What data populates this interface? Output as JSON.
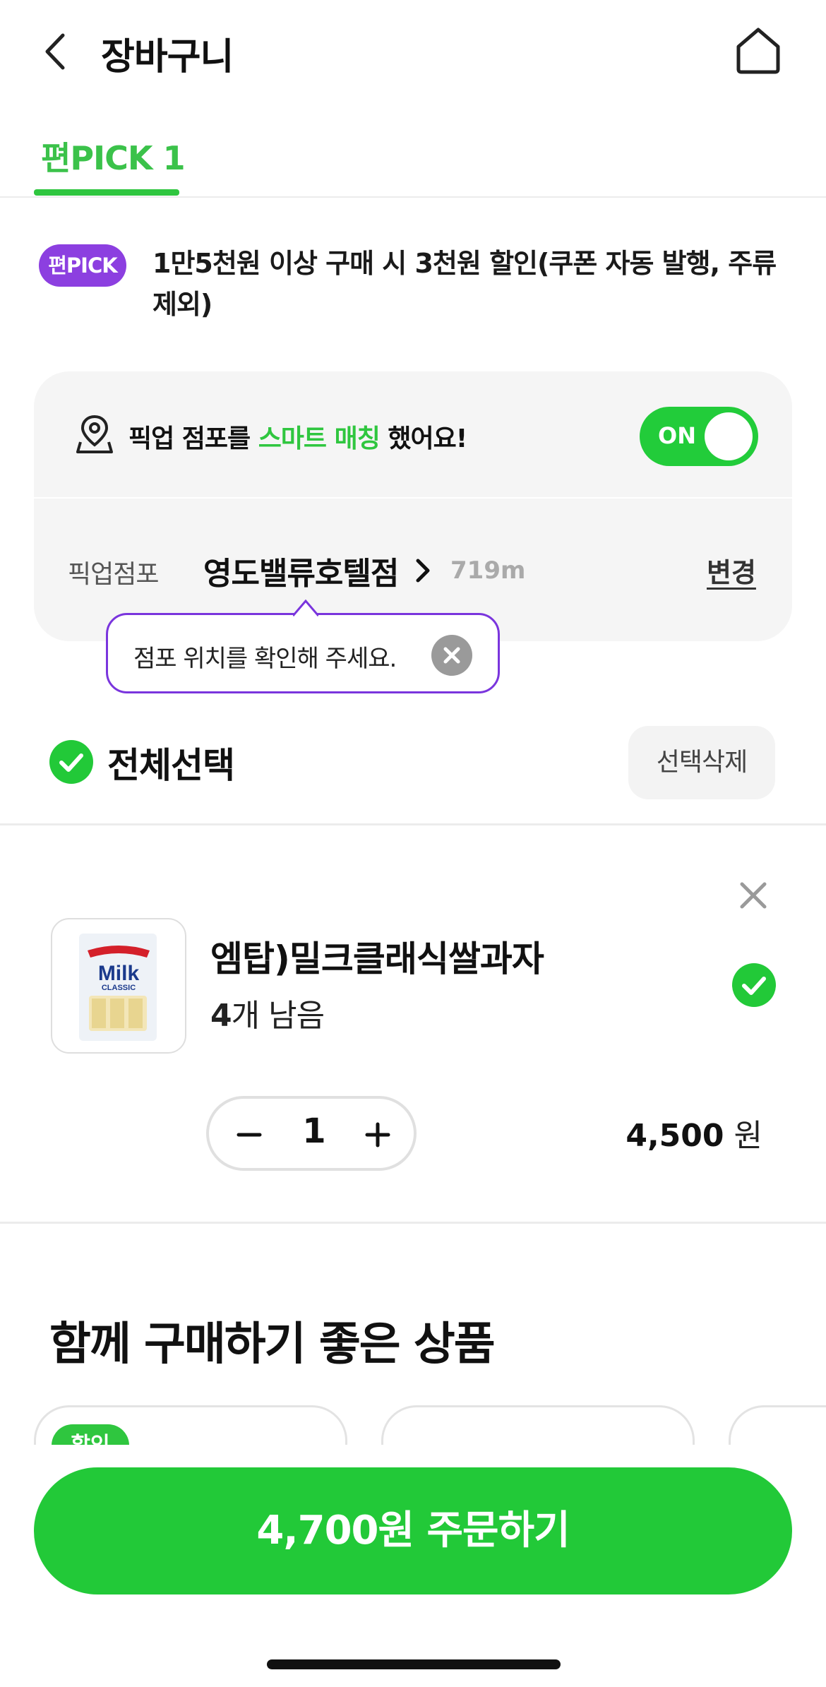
{
  "header": {
    "title": "장바구니",
    "back_icon": "chevron-left-icon",
    "home_icon": "home-icon"
  },
  "tabs": [
    {
      "label": "편PICK 1",
      "active": true
    }
  ],
  "promo": {
    "badge": "편PICK",
    "text": "1만5천원 이상 구매 시 3천원 할인(쿠폰 자동 발행, 주류 제외)"
  },
  "pickup": {
    "smart_prefix": "픽업 점포를",
    "smart_highlight": "스마트 매칭",
    "smart_suffix": "했어요!",
    "toggle_label": "ON",
    "toggle_on": true,
    "store_label": "픽업점포",
    "store_name": "영도밸류호텔점",
    "distance": "719m",
    "change_label": "변경"
  },
  "tooltip": {
    "text": "점포 위치를 확인해 주세요."
  },
  "selection": {
    "select_all_label": "전체선택",
    "delete_selected_label": "선택삭제",
    "all_selected": true
  },
  "cart_items": [
    {
      "name": "엠탑)밀크클래식쌀과자",
      "stock_count": "4",
      "stock_suffix": "개 남음",
      "quantity": "1",
      "price": "4,500",
      "price_unit": "원",
      "selected": true,
      "thumb_text": "Milk",
      "thumb_subtext": "CLASSIC"
    }
  ],
  "recommendations": {
    "title": "함께 구매하기 좋은 상품",
    "first_badge": "할인"
  },
  "order_button": {
    "label": "4,700원 주문하기"
  },
  "colors": {
    "brand_green": "#22c938",
    "accent_purple": "#8c3fe0",
    "tooltip_border": "#7a35dd"
  }
}
